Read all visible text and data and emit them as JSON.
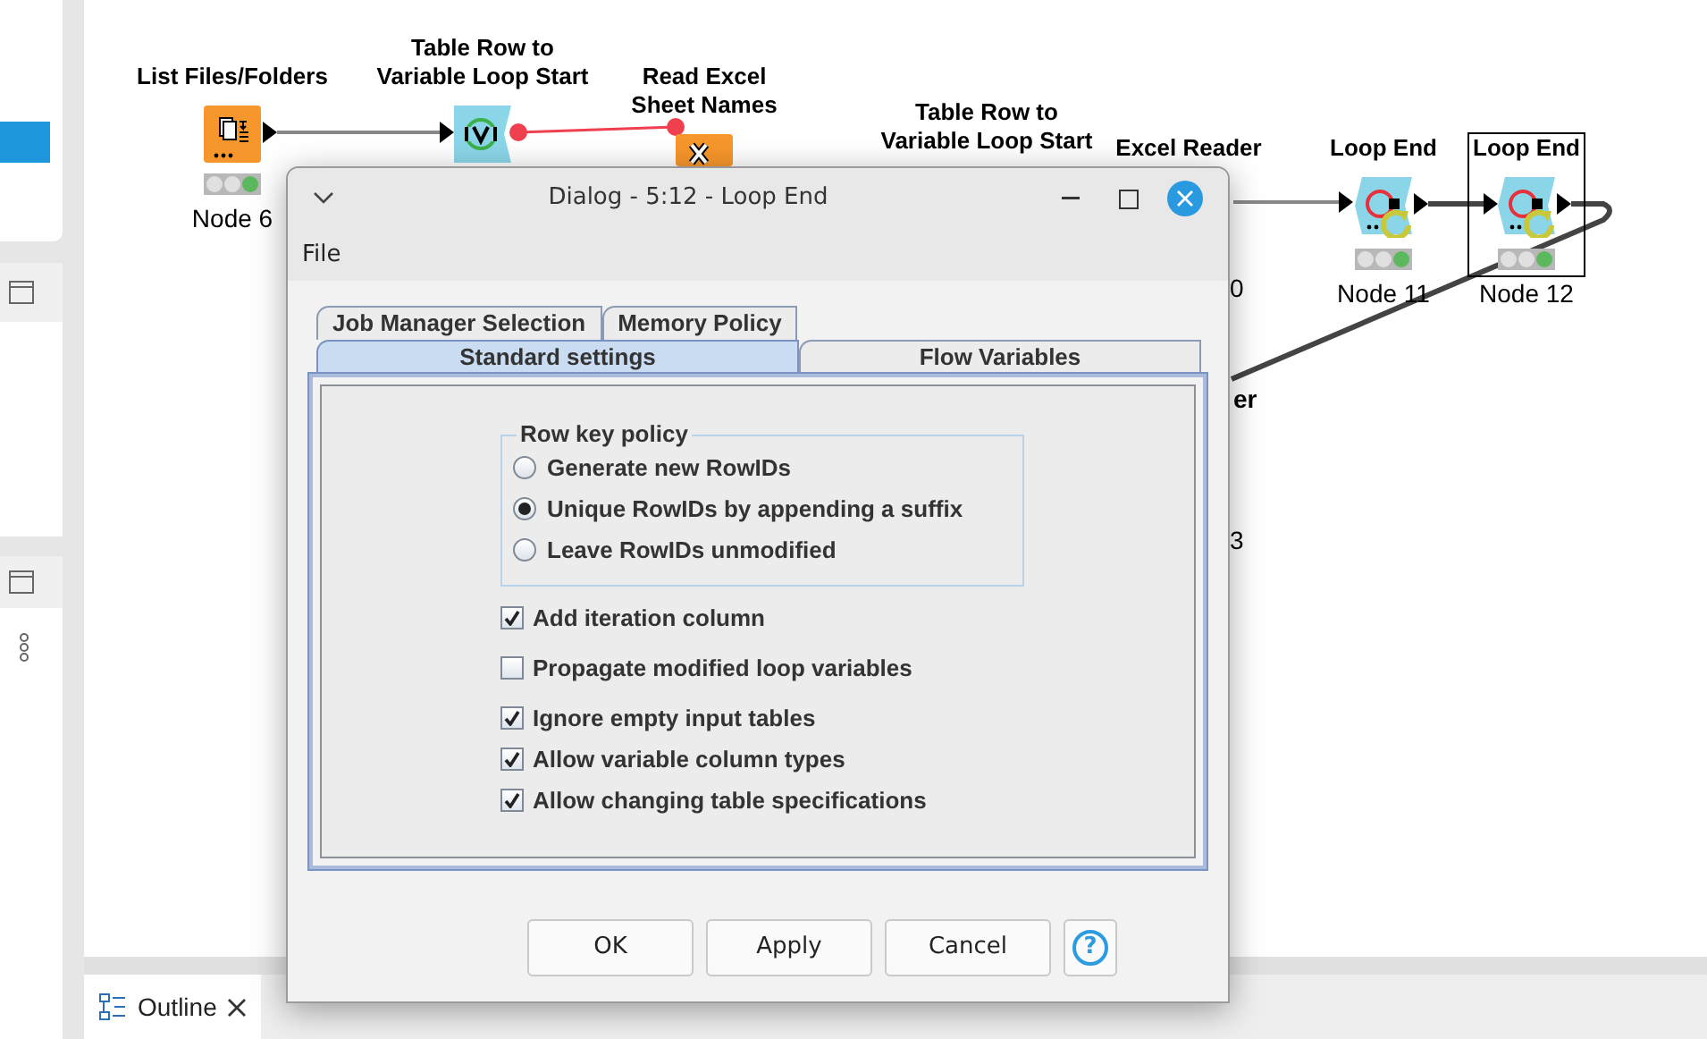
{
  "workflow": {
    "nodes": [
      {
        "label": "List Files/Folders",
        "kind": "files",
        "name": "Node 6",
        "executed": true,
        "selected": false
      },
      {
        "label": "Table Row to\nVariable Loop Start",
        "kind": "loop-start",
        "selected": false
      },
      {
        "label": "Read Excel\nSheet Names",
        "kind": "excel",
        "selected": false
      },
      {
        "label": "Table Row to\nVariable Loop Start",
        "selected": false
      },
      {
        "label": "Excel Reader",
        "selected": false
      },
      {
        "label": "Loop End",
        "kind": "loop-end",
        "name": "Node 11",
        "executed": true,
        "selected": false
      },
      {
        "label": "Loop End",
        "kind": "loop-end",
        "name": "Node 12",
        "executed": true,
        "selected": true
      }
    ],
    "clipped_texts": [
      "0",
      "er",
      "3"
    ]
  },
  "bottom_tabs": [
    {
      "label": "Outline",
      "selected": true
    }
  ],
  "dialog": {
    "title": "Dialog - 5:12 - Loop End",
    "menu": [
      "File"
    ],
    "tab_rows": [
      [
        {
          "label": "Job Manager Selection",
          "selected": false
        },
        {
          "label": "Memory Policy",
          "selected": false
        }
      ],
      [
        {
          "label": "Standard settings",
          "selected": true
        },
        {
          "label": "Flow Variables",
          "selected": false
        }
      ]
    ],
    "row_key_policy": {
      "title": "Row key policy",
      "options": [
        {
          "label": "Generate new RowIDs",
          "selected": false
        },
        {
          "label": "Unique RowIDs by appending a suffix",
          "selected": true
        },
        {
          "label": "Leave RowIDs unmodified",
          "selected": false
        }
      ]
    },
    "checkboxes": [
      {
        "label": "Add iteration column",
        "checked": true
      },
      {
        "label": "Propagate modified loop variables",
        "checked": false
      },
      {
        "label": "Ignore empty input tables",
        "checked": true
      },
      {
        "label": "Allow variable column types",
        "checked": true
      },
      {
        "label": "Allow changing table specifications",
        "checked": true
      }
    ],
    "buttons": [
      "OK",
      "Apply",
      "Cancel"
    ],
    "help_button": "?"
  }
}
